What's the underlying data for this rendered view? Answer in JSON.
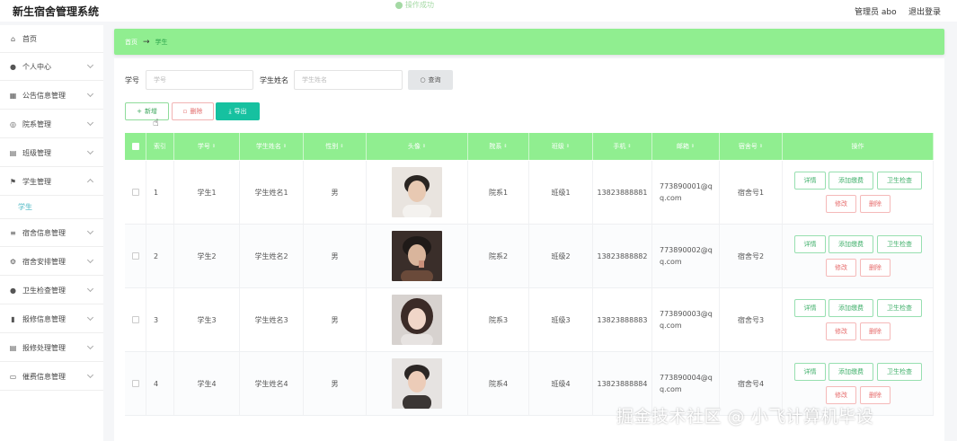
{
  "header": {
    "title": "新生宿舍管理系统",
    "center_text": "操作成功",
    "user": "管理员 abo",
    "logout": "退出登录"
  },
  "sidebar": {
    "items": [
      {
        "label": "首页",
        "icon": "home-icon",
        "glyph": "⌂"
      },
      {
        "label": "个人中心",
        "icon": "user-icon",
        "glyph": "●"
      },
      {
        "label": "公告信息管理",
        "icon": "grid-icon",
        "glyph": "▦"
      },
      {
        "label": "院系管理",
        "icon": "building-icon",
        "glyph": "◎"
      },
      {
        "label": "班级管理",
        "icon": "class-icon",
        "glyph": "▤"
      },
      {
        "label": "学生管理",
        "icon": "flag-icon",
        "glyph": "⚑"
      },
      {
        "label": "宿舍信息管理",
        "icon": "list-icon",
        "glyph": "≡"
      },
      {
        "label": "宿舍安排管理",
        "icon": "settings-icon",
        "glyph": "⚙"
      },
      {
        "label": "卫生检查管理",
        "icon": "person-icon",
        "glyph": "●"
      },
      {
        "label": "报修信息管理",
        "icon": "chart-icon",
        "glyph": "▮"
      },
      {
        "label": "报修处理管理",
        "icon": "doc-icon",
        "glyph": "▤"
      },
      {
        "label": "催费信息管理",
        "icon": "message-icon",
        "glyph": "▭"
      }
    ],
    "sub_active": "学生"
  },
  "breadcrumb": {
    "home": "首页",
    "current": "学生"
  },
  "search": {
    "id_label": "学号",
    "id_placeholder": "学号",
    "name_label": "学生姓名",
    "name_placeholder": "学生姓名",
    "query_button": "查询"
  },
  "toolbar": {
    "add": "新增",
    "delete": "删除",
    "export": "导出"
  },
  "table": {
    "headers": [
      "索引",
      "学号",
      "学生姓名",
      "性别",
      "头像",
      "院系",
      "班级",
      "手机",
      "邮箱",
      "宿舍号",
      "操作"
    ],
    "rows": [
      {
        "index": "1",
        "id": "学生1",
        "name": "学生姓名1",
        "gender": "男",
        "dept": "院系1",
        "class": "班级1",
        "phone": "13823888881",
        "email": "773890001@qq.com",
        "dorm": "宿舍号1"
      },
      {
        "index": "2",
        "id": "学生2",
        "name": "学生姓名2",
        "gender": "男",
        "dept": "院系2",
        "class": "班级2",
        "phone": "13823888882",
        "email": "773890002@qq.com",
        "dorm": "宿舍号2"
      },
      {
        "index": "3",
        "id": "学生3",
        "name": "学生姓名3",
        "gender": "男",
        "dept": "院系3",
        "class": "班级3",
        "phone": "13823888883",
        "email": "773890003@qq.com",
        "dorm": "宿舍号3"
      },
      {
        "index": "4",
        "id": "学生4",
        "name": "学生姓名4",
        "gender": "男",
        "dept": "院系4",
        "class": "班级4",
        "phone": "13823888884",
        "email": "773890004@qq.com",
        "dorm": "宿舍号4"
      }
    ],
    "actions": {
      "detail": "详情",
      "add_fee": "添加缴费",
      "hygiene": "卫生检查",
      "edit": "修改",
      "delete": "删除"
    }
  },
  "watermark": "掘金技术社区 @ 小飞计算机毕设",
  "colors": {
    "accent_green": "#90ee90",
    "export_teal": "#16c1a0",
    "danger": "#e66b6b"
  }
}
